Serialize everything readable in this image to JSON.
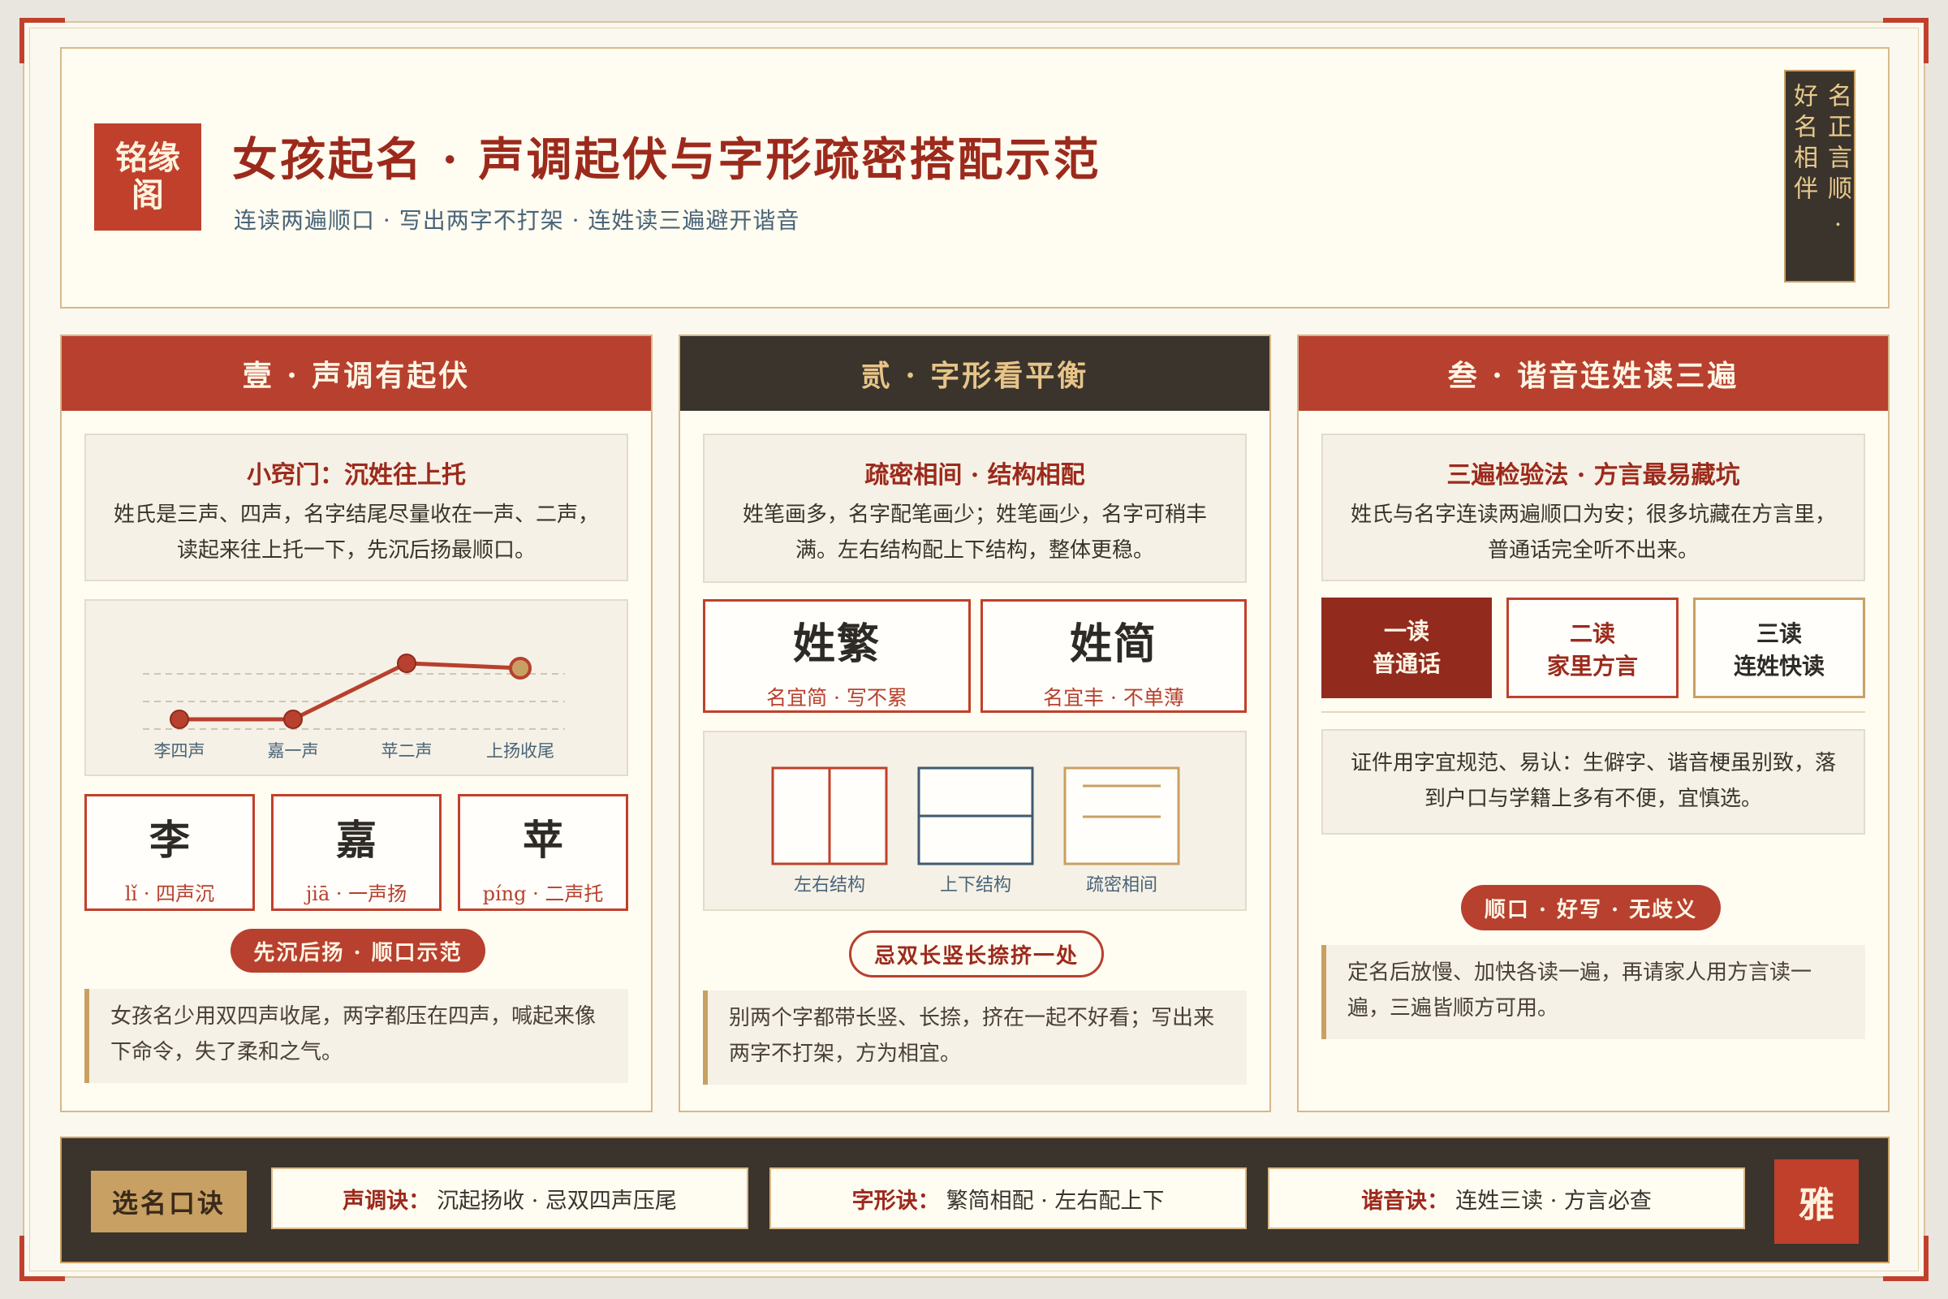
{
  "header": {
    "seal": "铭缘阁",
    "title": "女孩起名 · 声调起伏与字形疏密搭配示范",
    "subtitle": "连读两遍顺口 · 写出两字不打架 · 连姓读三遍避开谐音",
    "scroll_right": "名正言顺 ·",
    "scroll_left": "好名相伴"
  },
  "panel1": {
    "title": "壹 · 声调有起伏",
    "tip_title": "小窍门：沉姓往上托",
    "tip_text": "姓氏是三声、四声，名字结尾尽量收在一声、二声，读起来往上托一下，先沉后扬最顺口。",
    "chart_labels": [
      "李四声",
      "嘉一声",
      "苹二声",
      "上扬收尾"
    ],
    "chars": [
      {
        "ch": "李",
        "py": "lǐ · 四声沉"
      },
      {
        "ch": "嘉",
        "py": "jiā · 一声扬"
      },
      {
        "ch": "苹",
        "py": "píng · 二声托"
      }
    ],
    "pill": "先沉后扬 · 顺口示范",
    "note": "女孩名少用双四声收尾，两字都压在四声，喊起来像下命令，失了柔和之气。"
  },
  "panel2": {
    "title": "贰 · 字形看平衡",
    "tip_title": "疏密相间 · 结构相配",
    "tip_text": "姓笔画多，名字配笔画少；姓笔画少，名字可稍丰满。左右结构配上下结构，整体更稳。",
    "cards": [
      {
        "ch": "姓繁",
        "cap": "名宜简 · 写不累"
      },
      {
        "ch": "姓简",
        "cap": "名宜丰 · 不单薄"
      }
    ],
    "structures": [
      "左右结构",
      "上下结构",
      "疏密相间"
    ],
    "pill": "忌双长竖长捺挤一处",
    "note": "别两个字都带长竖、长捺，挤在一起不好看；写出来两字不打架，方为相宜。"
  },
  "panel3": {
    "title": "叁 · 谐音连姓读三遍",
    "tip_title": "三遍检验法 · 方言最易藏坑",
    "tip_text": "姓氏与名字连读两遍顺口为安；很多坑藏在方言里，普通话完全听不出来。",
    "reads": [
      {
        "a": "一读",
        "b": "普通话"
      },
      {
        "a": "二读",
        "b": "家里方言"
      },
      {
        "a": "三读",
        "b": "连姓快读"
      }
    ],
    "mid_text": "证件用字宜规范、易认：生僻字、谐音梗虽别致，落到户口与学籍上多有不便，宜慎选。",
    "pill": "顺口 · 好写 · 无歧义",
    "note": "定名后放慢、加快各读一遍，再请家人用方言读一遍，三遍皆顺方可用。"
  },
  "footer": {
    "label": "选名口诀",
    "items": [
      {
        "k": "声调诀：",
        "v": "沉起扬收 · 忌双四声压尾"
      },
      {
        "k": "字形诀：",
        "v": "繁简相配 · 左右配上下"
      },
      {
        "k": "谐音诀：",
        "v": "连姓三读 · 方言必查"
      }
    ],
    "seal": "雅"
  },
  "colors": {
    "red": "#b8402e",
    "dark": "#3a342c",
    "gold": "#c9a063",
    "cream": "#fbf8ef"
  },
  "chart_data": {
    "type": "line",
    "categories": [
      "李四声",
      "嘉一声",
      "苹二声",
      "上扬收尾"
    ],
    "values": [
      1,
      1,
      3.3,
      3.1
    ],
    "ylim": [
      0,
      4
    ],
    "grid": true
  }
}
